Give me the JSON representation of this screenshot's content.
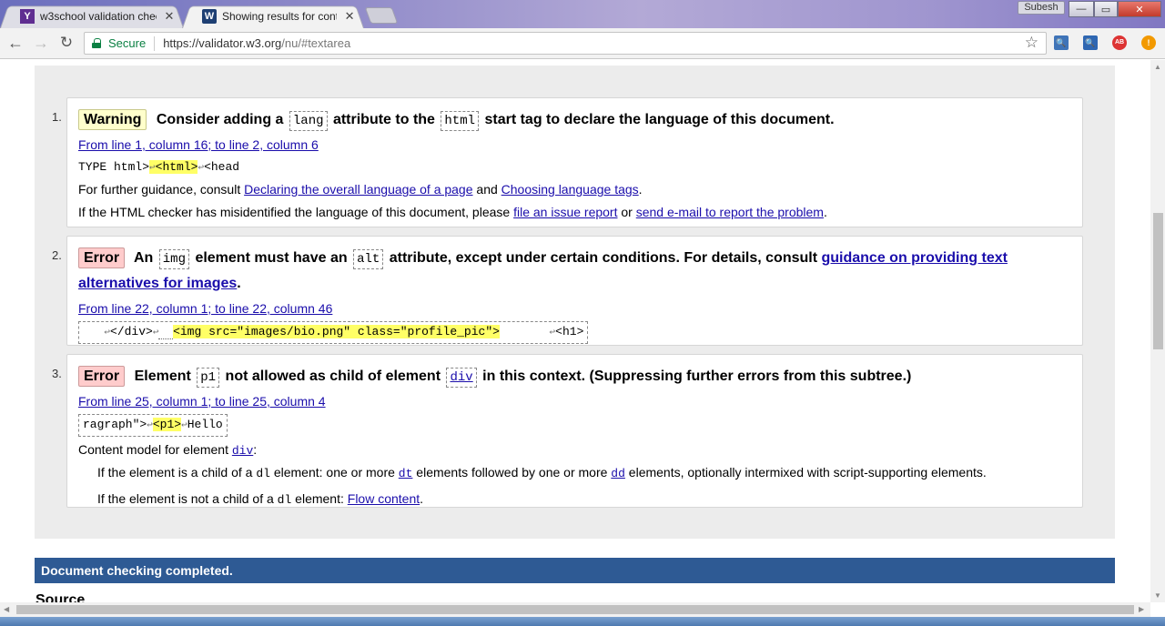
{
  "tabs": [
    {
      "title": "w3school validation chec",
      "favicon": "Y",
      "active": false
    },
    {
      "title": "Showing results for conte",
      "favicon": "W",
      "active": true
    }
  ],
  "window": {
    "profile": "Subesh"
  },
  "toolbar": {
    "secure_label": "Secure",
    "url_base": "https://validator.w3.org",
    "url_path": "/nu/#textarea"
  },
  "messages": [
    {
      "number": "1.",
      "badge": "Warning",
      "h1": "Consider adding a",
      "code1": "lang",
      "h2": "attribute to the",
      "code2": "html",
      "h3": "start tag to declare the language of this document.",
      "location": "From line 1, column 16; to line 2, column 6",
      "extract_pre": "TYPE html>",
      "extract_hl": "<html>",
      "extract_post": "<head",
      "guidance_pre": "For further guidance, consult",
      "guidance_link1": "Declaring the overall language of a page",
      "guidance_and": "and",
      "guidance_link2": "Choosing language tags",
      "guidance_end": ".",
      "misid_pre": "If the HTML checker has misidentified the language of this document, please",
      "misid_link1": "file an issue report",
      "misid_or": "or",
      "misid_link2": "send e-mail to report the problem",
      "misid_end": "."
    },
    {
      "number": "2.",
      "badge": "Error",
      "h1": "An",
      "code1": "img",
      "h2": "element must have an",
      "code2": "alt",
      "h3": "attribute, except under certain conditions. For details, consult",
      "link": "guidance on providing text alternatives for images",
      "h_end": ".",
      "location": "From line 22, column 1; to line 22, column 46",
      "extract_pre": "</div>",
      "extract_hl": "<img src=\"images/bio.png\" class=\"profile_pic\">",
      "extract_post": "<h1>"
    },
    {
      "number": "3.",
      "badge": "Error",
      "h1": "Element",
      "code1": "p1",
      "h2": "not allowed as child of element",
      "code2": "div",
      "h3": "in this context. (Suppressing further errors from this subtree.)",
      "location": "From line 25, column 1; to line 25, column 4",
      "extract_pre": "ragraph\">",
      "extract_hl": "<p1>",
      "extract_post": "Hello",
      "content_model_pre": "Content model for element",
      "content_model_code": "div",
      "content_model_end": ":",
      "cond1_pre": "If the element is a child of a",
      "cond1_code": "dl",
      "cond1_mid": "element: one or more",
      "cond1_link1": "dt",
      "cond1_mid2": "elements followed by one or more",
      "cond1_link2": "dd",
      "cond1_end": "elements, optionally intermixed with script-supporting elements.",
      "cond2_pre": "If the element is not a child of a",
      "cond2_code": "dl",
      "cond2_mid": "element:",
      "cond2_link": "Flow content",
      "cond2_end": "."
    }
  ],
  "status": {
    "done": "Document checking completed."
  },
  "source": {
    "heading": "Source"
  },
  "colors": {
    "accent": "#2e5a94",
    "warning": "#ffffcc",
    "error": "#ffcccc",
    "link": "#1a0dab",
    "secure": "#0b8043"
  },
  "icons": {
    "lf_marker": "↩"
  }
}
